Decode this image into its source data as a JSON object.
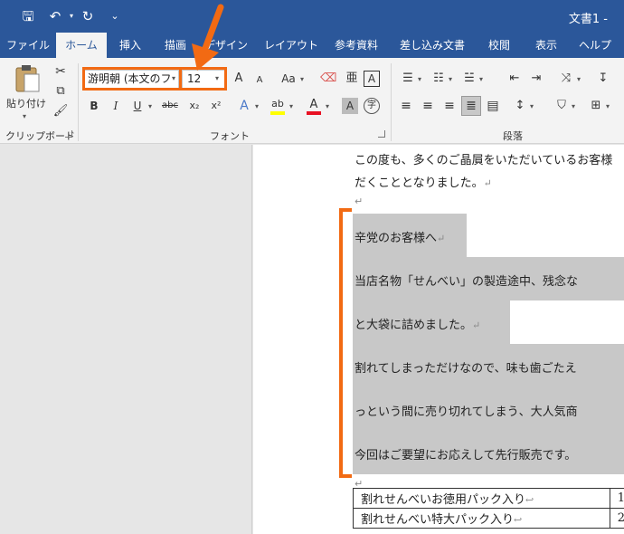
{
  "titlebar": {
    "doc_title": "文書1 -",
    "qat": [
      {
        "name": "save-icon",
        "glyph": "🖫"
      },
      {
        "name": "undo-icon",
        "glyph": "↶"
      },
      {
        "name": "redo-icon",
        "glyph": "↻"
      },
      {
        "name": "customize-icon",
        "glyph": "⌄"
      }
    ]
  },
  "tabs": [
    {
      "label": "ファイル",
      "active": false
    },
    {
      "label": "ホーム",
      "active": true
    },
    {
      "label": "挿入",
      "active": false
    },
    {
      "label": "描画",
      "active": false
    },
    {
      "label": "デザイン",
      "active": false
    },
    {
      "label": "レイアウト",
      "active": false
    },
    {
      "label": "参考資料",
      "active": false
    },
    {
      "label": "差し込み文書",
      "active": false
    },
    {
      "label": "校閲",
      "active": false
    },
    {
      "label": "表示",
      "active": false
    },
    {
      "label": "ヘルプ",
      "active": false
    }
  ],
  "ribbon": {
    "clipboard": {
      "paste_label": "貼り付け",
      "group_label": "クリップボード"
    },
    "font": {
      "font_name": "游明朝 (本文のフ",
      "font_size": "12",
      "group_label": "フォント",
      "grow": "A",
      "shrink": "A",
      "case": "Aa",
      "bold": "B",
      "italic": "I",
      "underline": "U",
      "strike": "abc",
      "subscript": "x₂",
      "superscript": "x²"
    },
    "paragraph": {
      "group_label": "段落"
    }
  },
  "document": {
    "intro_lines": [
      "この度も、多くのご晶屓をいただいているお客様",
      "だくこととなりました。"
    ],
    "selected_lines": [
      "辛党のお客様へ",
      "当店名物「せんべい」の製造途中、残念な",
      "と大袋に詰めました。",
      "割れてしまっただけなので、味も歯ごたえ",
      "っという間に売り切れてしまう、大人気商",
      "今回はご要望にお応えして先行販売です。"
    ],
    "return_mark": "↵",
    "table_rows": [
      {
        "name": "割れせんべいお徳用パック入り",
        "value": "1"
      },
      {
        "name": "割れせんべい特大パック入り",
        "value": "2"
      }
    ]
  },
  "colors": {
    "accent": "#2b579a",
    "annotation": "#f26a13",
    "selection": "#c8c8c8",
    "font_color": "#e81123",
    "highlight": "#ffff00"
  }
}
